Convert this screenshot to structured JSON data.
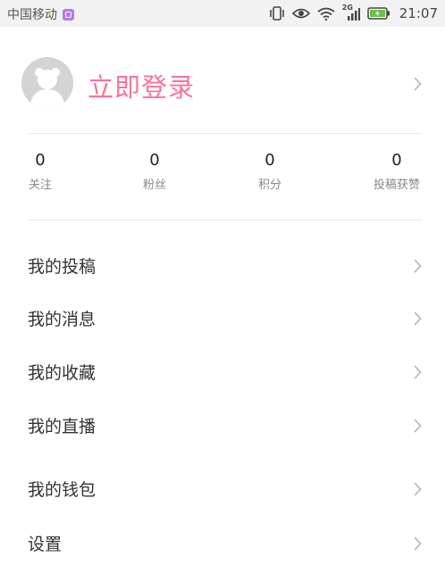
{
  "status_bar": {
    "carrier": "中国移动",
    "network": "2G",
    "time": "21:07"
  },
  "profile": {
    "login_label": "立即登录",
    "accent_color": "#fb7299"
  },
  "stats": [
    {
      "value": "0",
      "label": "关注"
    },
    {
      "value": "0",
      "label": "粉丝"
    },
    {
      "value": "0",
      "label": "积分"
    },
    {
      "value": "0",
      "label": "投稿获赞"
    }
  ],
  "menu": [
    {
      "label": "我的投稿"
    },
    {
      "label": "我的消息"
    },
    {
      "label": "我的收藏"
    },
    {
      "label": "我的直播"
    },
    {
      "label": "我的钱包"
    },
    {
      "label": "设置"
    }
  ]
}
